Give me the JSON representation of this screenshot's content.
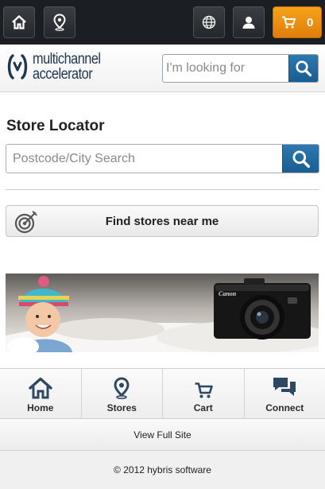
{
  "topbar": {
    "icons": [
      "home-icon",
      "location-pin-icon",
      "globe-icon",
      "user-icon",
      "cart-icon"
    ],
    "cart_count": "0",
    "cart_color": "#ef9614"
  },
  "header": {
    "logo_line1": "multichannel",
    "logo_line2": "accelerator",
    "search_placeholder": "I'm looking for"
  },
  "main": {
    "title": "Store Locator",
    "search_placeholder": "Postcode/City Search",
    "find_label": "Find stores near me"
  },
  "banner": {
    "camera_brand": "Canon"
  },
  "bottom_nav": {
    "items": [
      {
        "label": "Home",
        "icon": "home-icon"
      },
      {
        "label": "Stores",
        "icon": "location-pin-icon"
      },
      {
        "label": "Cart",
        "icon": "cart-icon"
      },
      {
        "label": "Connect",
        "icon": "chat-icon"
      }
    ],
    "full_site": "View Full Site"
  },
  "footer": {
    "copyright": "© 2012 hybris software"
  },
  "colors": {
    "accent_blue": "#1f6aa3",
    "topbar": "#1b1e22",
    "cart_orange": "#ef9614"
  }
}
